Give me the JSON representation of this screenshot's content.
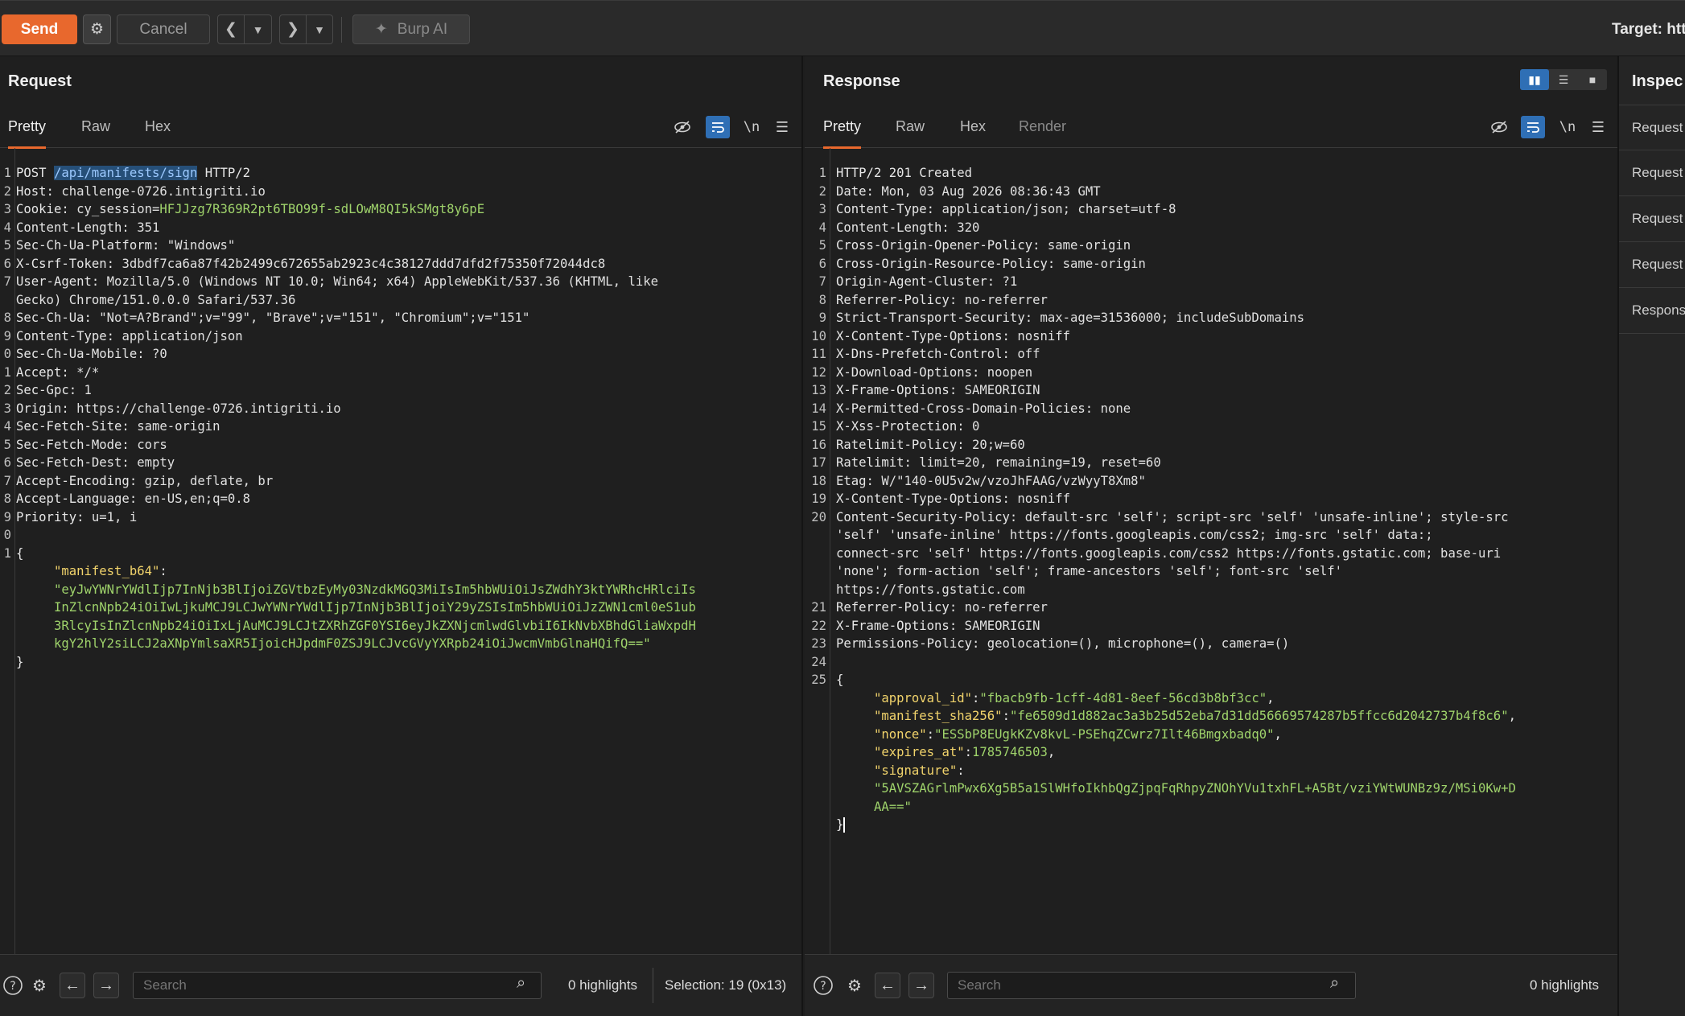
{
  "toolbar": {
    "send": "Send",
    "cancel": "Cancel",
    "burp_ai": "Burp AI",
    "target_label": "Target: htt",
    "icons": [
      "gear-icon",
      "chevron-left-icon",
      "chevron-down-icon",
      "chevron-right-icon",
      "sparkle-icon"
    ]
  },
  "request": {
    "title": "Request",
    "tabs": [
      "Pretty",
      "Raw",
      "Hex"
    ],
    "active_tab": "Pretty",
    "lines": [
      {
        "n": "1",
        "parts": [
          [
            "k",
            "POST "
          ],
          [
            "sel",
            "/api/manifests/sign"
          ],
          [
            "k",
            " HTTP/2"
          ]
        ]
      },
      {
        "n": "2",
        "parts": [
          [
            "k",
            "Host: "
          ],
          [
            "v",
            "challenge-0726.intigriti.io"
          ]
        ]
      },
      {
        "n": "3",
        "parts": [
          [
            "k",
            "Cookie: "
          ],
          [
            "v",
            "cy_session="
          ],
          [
            "g",
            "HFJJzg7R369R2pt6TBO99f-sdLOwM8QI5kSMgt8y6pE"
          ]
        ]
      },
      {
        "n": "4",
        "parts": [
          [
            "k",
            "Content-Length: "
          ],
          [
            "v",
            "351"
          ]
        ]
      },
      {
        "n": "5",
        "parts": [
          [
            "k",
            "Sec-Ch-Ua-Platform: "
          ],
          [
            "v",
            "\"Windows\""
          ]
        ]
      },
      {
        "n": "6",
        "parts": [
          [
            "k",
            "X-Csrf-Token: "
          ],
          [
            "v",
            "3dbdf7ca6a87f42b2499c672655ab2923c4c38127ddd7dfd2f75350f72044dc8"
          ]
        ]
      },
      {
        "n": "7",
        "parts": [
          [
            "k",
            "User-Agent: "
          ],
          [
            "v",
            "Mozilla/5.0 (Windows NT 10.0; Win64; x64) AppleWebKit/537.36 (KHTML, like"
          ]
        ]
      },
      {
        "n": "",
        "parts": [
          [
            "v",
            "Gecko) Chrome/151.0.0.0 Safari/537.36"
          ]
        ]
      },
      {
        "n": "8",
        "parts": [
          [
            "k",
            "Sec-Ch-Ua: "
          ],
          [
            "v",
            "\"Not=A?Brand\";v=\"99\", \"Brave\";v=\"151\", \"Chromium\";v=\"151\""
          ]
        ]
      },
      {
        "n": "9",
        "parts": [
          [
            "k",
            "Content-Type: "
          ],
          [
            "v",
            "application/json"
          ]
        ]
      },
      {
        "n": "0",
        "parts": [
          [
            "k",
            "Sec-Ch-Ua-Mobile: "
          ],
          [
            "v",
            "?0"
          ]
        ]
      },
      {
        "n": "1",
        "parts": [
          [
            "k",
            "Accept: "
          ],
          [
            "v",
            "*/*"
          ]
        ]
      },
      {
        "n": "2",
        "parts": [
          [
            "k",
            "Sec-Gpc: "
          ],
          [
            "v",
            "1"
          ]
        ]
      },
      {
        "n": "3",
        "parts": [
          [
            "k",
            "Origin: "
          ],
          [
            "v",
            "https://challenge-0726.intigriti.io"
          ]
        ]
      },
      {
        "n": "4",
        "parts": [
          [
            "k",
            "Sec-Fetch-Site: "
          ],
          [
            "v",
            "same-origin"
          ]
        ]
      },
      {
        "n": "5",
        "parts": [
          [
            "k",
            "Sec-Fetch-Mode: "
          ],
          [
            "v",
            "cors"
          ]
        ]
      },
      {
        "n": "6",
        "parts": [
          [
            "k",
            "Sec-Fetch-Dest: "
          ],
          [
            "v",
            "empty"
          ]
        ]
      },
      {
        "n": "7",
        "parts": [
          [
            "k",
            "Accept-Encoding: "
          ],
          [
            "v",
            "gzip, deflate, br"
          ]
        ]
      },
      {
        "n": "8",
        "parts": [
          [
            "k",
            "Accept-Language: "
          ],
          [
            "v",
            "en-US,en;q=0.8"
          ]
        ]
      },
      {
        "n": "9",
        "parts": [
          [
            "k",
            "Priority: "
          ],
          [
            "v",
            "u=1, i"
          ]
        ]
      },
      {
        "n": "0",
        "parts": []
      },
      {
        "n": "1",
        "parts": [
          [
            "k",
            "{"
          ]
        ]
      },
      {
        "n": "",
        "parts": [
          [
            "k",
            "     "
          ],
          [
            "pk",
            "\"manifest_b64\""
          ],
          [
            "k",
            ":"
          ]
        ]
      },
      {
        "n": "",
        "parts": [
          [
            "g",
            "     \"eyJwYWNrYWdlIjp7InNjb3BlIjoiZGVtbzEyMy03NzdkMGQ3MiIsIm5hbWUiOiJsZWdhY3ktYWRhcHRlciIs"
          ]
        ]
      },
      {
        "n": "",
        "parts": [
          [
            "g",
            "     InZlcnNpb24iOiIwLjkuMCJ9LCJwYWNrYWdlIjp7InNjb3BlIjoiY29yZSIsIm5hbWUiOiJzZWN1cml0eS1ub"
          ]
        ]
      },
      {
        "n": "",
        "parts": [
          [
            "g",
            "     3RlcyIsInZlcnNpb24iOiIxLjAuMCJ9LCJtZXRhZGF0YSI6eyJkZXNjcmlwdGlvbiI6IkNvbXBhdGliaWxpdH"
          ]
        ]
      },
      {
        "n": "",
        "parts": [
          [
            "g",
            "     kgY2hlY2siLCJ2aXNpYmlsaXR5IjoicHJpdmF0ZSJ9LCJvcGVyYXRpb24iOiJwcmVmbGlnaHQifQ==\""
          ]
        ]
      },
      {
        "n": "",
        "parts": [
          [
            "k",
            "}"
          ]
        ]
      }
    ],
    "footer": {
      "search_placeholder": "Search",
      "highlights": "0 highlights",
      "selection": "Selection: 19 (0x13)"
    }
  },
  "response": {
    "title": "Response",
    "tabs": [
      "Pretty",
      "Raw",
      "Hex",
      "Render"
    ],
    "active_tab": "Pretty",
    "lines": [
      {
        "n": "1",
        "parts": [
          [
            "k",
            "HTTP/2 201 Created"
          ]
        ]
      },
      {
        "n": "2",
        "parts": [
          [
            "k",
            "Date: "
          ],
          [
            "v",
            "Mon, 03 Aug 2026 08:36:43 GMT"
          ]
        ]
      },
      {
        "n": "3",
        "parts": [
          [
            "k",
            "Content-Type: "
          ],
          [
            "v",
            "application/json; charset=utf-8"
          ]
        ]
      },
      {
        "n": "4",
        "parts": [
          [
            "k",
            "Content-Length: "
          ],
          [
            "v",
            "320"
          ]
        ]
      },
      {
        "n": "5",
        "parts": [
          [
            "k",
            "Cross-Origin-Opener-Policy: "
          ],
          [
            "v",
            "same-origin"
          ]
        ]
      },
      {
        "n": "6",
        "parts": [
          [
            "k",
            "Cross-Origin-Resource-Policy: "
          ],
          [
            "v",
            "same-origin"
          ]
        ]
      },
      {
        "n": "7",
        "parts": [
          [
            "k",
            "Origin-Agent-Cluster: "
          ],
          [
            "v",
            "?1"
          ]
        ]
      },
      {
        "n": "8",
        "parts": [
          [
            "k",
            "Referrer-Policy: "
          ],
          [
            "v",
            "no-referrer"
          ]
        ]
      },
      {
        "n": "9",
        "parts": [
          [
            "k",
            "Strict-Transport-Security: "
          ],
          [
            "v",
            "max-age=31536000; includeSubDomains"
          ]
        ]
      },
      {
        "n": "10",
        "parts": [
          [
            "k",
            "X-Content-Type-Options: "
          ],
          [
            "v",
            "nosniff"
          ]
        ]
      },
      {
        "n": "11",
        "parts": [
          [
            "k",
            "X-Dns-Prefetch-Control: "
          ],
          [
            "v",
            "off"
          ]
        ]
      },
      {
        "n": "12",
        "parts": [
          [
            "k",
            "X-Download-Options: "
          ],
          [
            "v",
            "noopen"
          ]
        ]
      },
      {
        "n": "13",
        "parts": [
          [
            "k",
            "X-Frame-Options: "
          ],
          [
            "v",
            "SAMEORIGIN"
          ]
        ]
      },
      {
        "n": "14",
        "parts": [
          [
            "k",
            "X-Permitted-Cross-Domain-Policies: "
          ],
          [
            "v",
            "none"
          ]
        ]
      },
      {
        "n": "15",
        "parts": [
          [
            "k",
            "X-Xss-Protection: "
          ],
          [
            "v",
            "0"
          ]
        ]
      },
      {
        "n": "16",
        "parts": [
          [
            "k",
            "Ratelimit-Policy: "
          ],
          [
            "v",
            "20;w=60"
          ]
        ]
      },
      {
        "n": "17",
        "parts": [
          [
            "k",
            "Ratelimit: "
          ],
          [
            "v",
            "limit=20, remaining=19, reset=60"
          ]
        ]
      },
      {
        "n": "18",
        "parts": [
          [
            "k",
            "Etag: "
          ],
          [
            "v",
            "W/\"140-0U5v2w/vzoJhFAAG/vzWyyT8Xm8\""
          ]
        ]
      },
      {
        "n": "19",
        "parts": [
          [
            "k",
            "X-Content-Type-Options: "
          ],
          [
            "v",
            "nosniff"
          ]
        ]
      },
      {
        "n": "20",
        "parts": [
          [
            "k",
            "Content-Security-Policy: "
          ],
          [
            "v",
            "default-src 'self'; script-src 'self' 'unsafe-inline'; style-src"
          ]
        ]
      },
      {
        "n": "",
        "parts": [
          [
            "v",
            "'self' 'unsafe-inline' https://fonts.googleapis.com/css2; img-src 'self' data:;"
          ]
        ]
      },
      {
        "n": "",
        "parts": [
          [
            "v",
            "connect-src 'self' https://fonts.googleapis.com/css2 https://fonts.gstatic.com; base-uri"
          ]
        ]
      },
      {
        "n": "",
        "parts": [
          [
            "v",
            "'none'; form-action 'self'; frame-ancestors 'self'; font-src 'self'"
          ]
        ]
      },
      {
        "n": "",
        "parts": [
          [
            "v",
            "https://fonts.gstatic.com"
          ]
        ]
      },
      {
        "n": "21",
        "parts": [
          [
            "k",
            "Referrer-Policy: "
          ],
          [
            "v",
            "no-referrer"
          ]
        ]
      },
      {
        "n": "22",
        "parts": [
          [
            "k",
            "X-Frame-Options: "
          ],
          [
            "v",
            "SAMEORIGIN"
          ]
        ]
      },
      {
        "n": "23",
        "parts": [
          [
            "k",
            "Permissions-Policy: "
          ],
          [
            "v",
            "geolocation=(), microphone=(), camera=()"
          ]
        ]
      },
      {
        "n": "24",
        "parts": []
      },
      {
        "n": "25",
        "parts": [
          [
            "k",
            "{"
          ]
        ]
      },
      {
        "n": "",
        "parts": [
          [
            "k",
            "     "
          ],
          [
            "pk",
            "\"approval_id\""
          ],
          [
            "k",
            ":"
          ],
          [
            "g",
            "\"fbacb9fb-1cff-4d81-8eef-56cd3b8bf3cc\""
          ],
          [
            "k",
            ","
          ]
        ]
      },
      {
        "n": "",
        "parts": [
          [
            "k",
            "     "
          ],
          [
            "pk",
            "\"manifest_sha256\""
          ],
          [
            "k",
            ":"
          ],
          [
            "g",
            "\"fe6509d1d882ac3a3b25d52eba7d31dd56669574287b5ffcc6d2042737b4f8c6\""
          ],
          [
            "k",
            ","
          ]
        ]
      },
      {
        "n": "",
        "parts": [
          [
            "k",
            "     "
          ],
          [
            "pk",
            "\"nonce\""
          ],
          [
            "k",
            ":"
          ],
          [
            "g",
            "\"ESSbP8EUgkKZv8kvL-PSEhqZCwrz7Ilt46Bmgxbadq0\""
          ],
          [
            "k",
            ","
          ]
        ]
      },
      {
        "n": "",
        "parts": [
          [
            "k",
            "     "
          ],
          [
            "pk",
            "\"expires_at\""
          ],
          [
            "k",
            ":"
          ],
          [
            "g",
            "1785746503"
          ],
          [
            "k",
            ","
          ]
        ]
      },
      {
        "n": "",
        "parts": [
          [
            "k",
            "     "
          ],
          [
            "pk",
            "\"signature\""
          ],
          [
            "k",
            ":"
          ]
        ]
      },
      {
        "n": "",
        "parts": [
          [
            "g",
            "     \"5AVSZAGrlmPwx6Xg5B5a1SlWHfoIkhbQgZjpqFqRhpyZNOhYVu1txhFL+A5Bt/vziYWtWUNBz9z/MSi0Kw+D"
          ]
        ]
      },
      {
        "n": "",
        "parts": [
          [
            "g",
            "     AA==\""
          ]
        ]
      },
      {
        "n": "",
        "parts": [
          [
            "k",
            "}"
          ],
          [
            "caret",
            ""
          ]
        ]
      }
    ],
    "footer": {
      "search_placeholder": "Search",
      "highlights": "0 highlights"
    }
  },
  "inspector": {
    "title": "Inspec",
    "items": [
      "Request",
      "Request",
      "Request",
      "Request",
      "Respons"
    ]
  }
}
